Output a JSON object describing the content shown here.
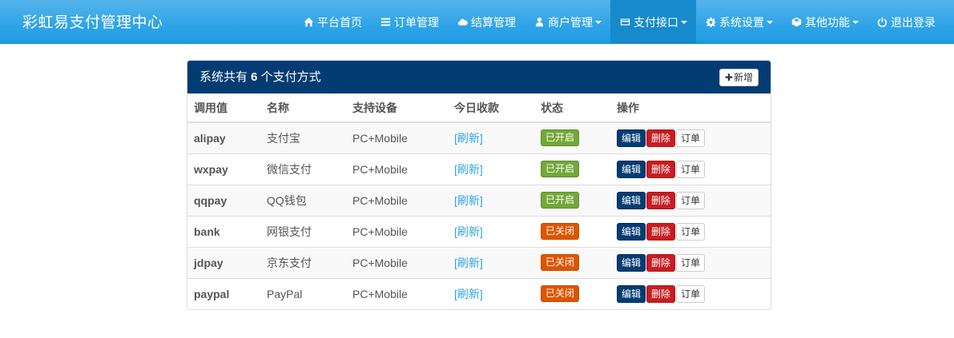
{
  "brand": "彩虹易支付管理中心",
  "nav": {
    "items": [
      {
        "label": "平台首页",
        "icon": "home-icon",
        "dropdown": false,
        "active": false
      },
      {
        "label": "订单管理",
        "icon": "list-icon",
        "dropdown": false,
        "active": false
      },
      {
        "label": "结算管理",
        "icon": "cloud-icon",
        "dropdown": false,
        "active": false
      },
      {
        "label": "商户管理",
        "icon": "user-icon",
        "dropdown": true,
        "active": false
      },
      {
        "label": "支付接口",
        "icon": "credit-card-icon",
        "dropdown": true,
        "active": true
      },
      {
        "label": "系统设置",
        "icon": "gear-icon",
        "dropdown": true,
        "active": false
      },
      {
        "label": "其他功能",
        "icon": "cube-icon",
        "dropdown": true,
        "active": false
      },
      {
        "label": "退出登录",
        "icon": "power-icon",
        "dropdown": false,
        "active": false
      }
    ]
  },
  "panel": {
    "title_prefix": "系统共有 ",
    "count": "6",
    "title_suffix": " 个支付方式",
    "add_button": "新增",
    "add_icon": "plus-icon"
  },
  "table": {
    "headers": [
      "调用值",
      "名称",
      "支持设备",
      "今日收款",
      "状态",
      "操作"
    ],
    "rows": [
      {
        "code": "alipay",
        "name": "支付宝",
        "device": "PC+Mobile",
        "income": "[刷新]",
        "status": "已开启",
        "status_on": true
      },
      {
        "code": "wxpay",
        "name": "微信支付",
        "device": "PC+Mobile",
        "income": "[刷新]",
        "status": "已开启",
        "status_on": true
      },
      {
        "code": "qqpay",
        "name": "QQ钱包",
        "device": "PC+Mobile",
        "income": "[刷新]",
        "status": "已开启",
        "status_on": true
      },
      {
        "code": "bank",
        "name": "网银支付",
        "device": "PC+Mobile",
        "income": "[刷新]",
        "status": "已关闭",
        "status_on": false
      },
      {
        "code": "jdpay",
        "name": "京东支付",
        "device": "PC+Mobile",
        "income": "[刷新]",
        "status": "已关闭",
        "status_on": false
      },
      {
        "code": "paypal",
        "name": "PayPal",
        "device": "PC+Mobile",
        "income": "[刷新]",
        "status": "已关闭",
        "status_on": false
      }
    ],
    "actions": {
      "edit": "编辑",
      "delete": "删除",
      "order": "订单"
    }
  },
  "colors": {
    "navbar": "#2fa4e7",
    "panel_heading": "#033c73",
    "status_on": "#73a839",
    "status_off": "#dd5600",
    "edit": "#033c73",
    "delete": "#c71c22"
  }
}
